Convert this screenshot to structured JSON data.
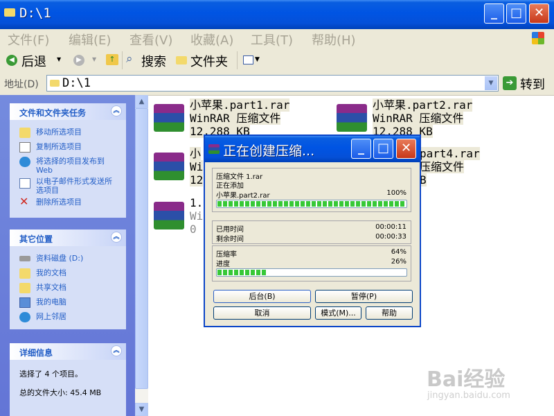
{
  "window": {
    "title": "D:\\1"
  },
  "menu": [
    "文件(F)",
    "编辑(E)",
    "查看(V)",
    "收藏(A)",
    "工具(T)",
    "帮助(H)"
  ],
  "toolbar": {
    "back": "后退",
    "search": "搜索",
    "folders": "文件夹"
  },
  "address": {
    "label": "地址(D)",
    "value": "D:\\1",
    "go": "转到"
  },
  "tasks_panel": {
    "title": "文件和文件夹任务",
    "items": [
      "移动所选项目",
      "复制所选项目",
      "将选择的项目发布到 Web",
      "以电子邮件形式发送所选项目",
      "删除所选项目"
    ]
  },
  "places_panel": {
    "title": "其它位置",
    "items": [
      "资料磁盘 (D:)",
      "我的文档",
      "共享文档",
      "我的电脑",
      "网上邻居"
    ]
  },
  "details_panel": {
    "title": "详细信息",
    "selected": "选择了 4 个项目。",
    "total_size": "总的文件大小: 45.4 MB"
  },
  "files": [
    {
      "name": "小苹果.part1.rar",
      "type": "WinRAR 压缩文件",
      "size": "12,288 KB"
    },
    {
      "name": "小苹果.part2.rar",
      "type": "WinRAR 压缩文件",
      "size": "12,288 KB"
    },
    {
      "name": "小",
      "type": "Wi",
      "size": "12"
    },
    {
      "name": "part4.rar",
      "type": "压缩文件",
      "size": "B"
    },
    {
      "name": "1.",
      "type": "Wi",
      "size": "0"
    }
  ],
  "dialog": {
    "title": "正在创建压缩...",
    "archive": "压缩文件 1.rar",
    "adding": "正在添加",
    "current_file": "小苹果.part2.rar",
    "file_percent": "100%",
    "file_progress": 1.0,
    "elapsed_label": "已用时间",
    "elapsed": "00:00:11",
    "remaining_label": "剩余时间",
    "remaining": "00:00:33",
    "ratio_label": "压缩率",
    "ratio": "64%",
    "progress_label": "进度",
    "progress_percent": "26%",
    "total_progress": 0.26,
    "buttons": {
      "background": "后台(B)",
      "pause": "暂停(P)",
      "cancel": "取消",
      "mode": "模式(M)...",
      "help": "帮助"
    }
  },
  "watermark": {
    "main": "Bai经验",
    "sub": "jingyan.baidu.com"
  }
}
